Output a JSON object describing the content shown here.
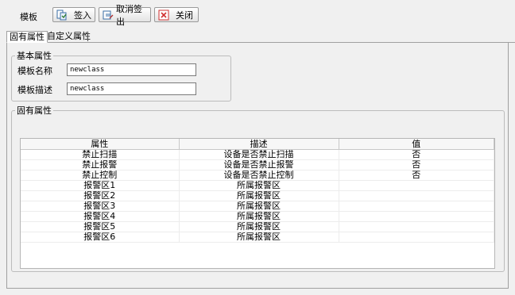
{
  "toolbar": {
    "label": "模板",
    "buttons": [
      {
        "label": "签入",
        "icon": "checkin-icon"
      },
      {
        "label": "取消签出",
        "icon": "undo-checkout-icon"
      },
      {
        "label": "关闭",
        "icon": "close-icon"
      }
    ]
  },
  "tabs": [
    {
      "label": "固有属性",
      "active": true
    },
    {
      "label": "自定义属性",
      "active": false
    }
  ],
  "basic": {
    "legend": "基本属性",
    "name_label": "模板名称",
    "name_value": "newclass",
    "desc_label": "模板描述",
    "desc_value": "newclass"
  },
  "props": {
    "legend": "固有属性",
    "columns": [
      "属性",
      "描述",
      "值"
    ],
    "rows": [
      [
        "禁止扫描",
        "设备是否禁止扫描",
        "否"
      ],
      [
        "禁止报警",
        "设备是否禁止报警",
        "否"
      ],
      [
        "禁止控制",
        "设备是否禁止控制",
        "否"
      ],
      [
        "报警区1",
        "所属报警区",
        ""
      ],
      [
        "报警区2",
        "所属报警区",
        ""
      ],
      [
        "报警区3",
        "所属报警区",
        ""
      ],
      [
        "报警区4",
        "所属报警区",
        ""
      ],
      [
        "报警区5",
        "所属报警区",
        ""
      ],
      [
        "报警区6",
        "所属报警区",
        ""
      ]
    ]
  },
  "colors": {
    "close_icon": "#d03030",
    "window_bg": "#f0f0f0"
  }
}
